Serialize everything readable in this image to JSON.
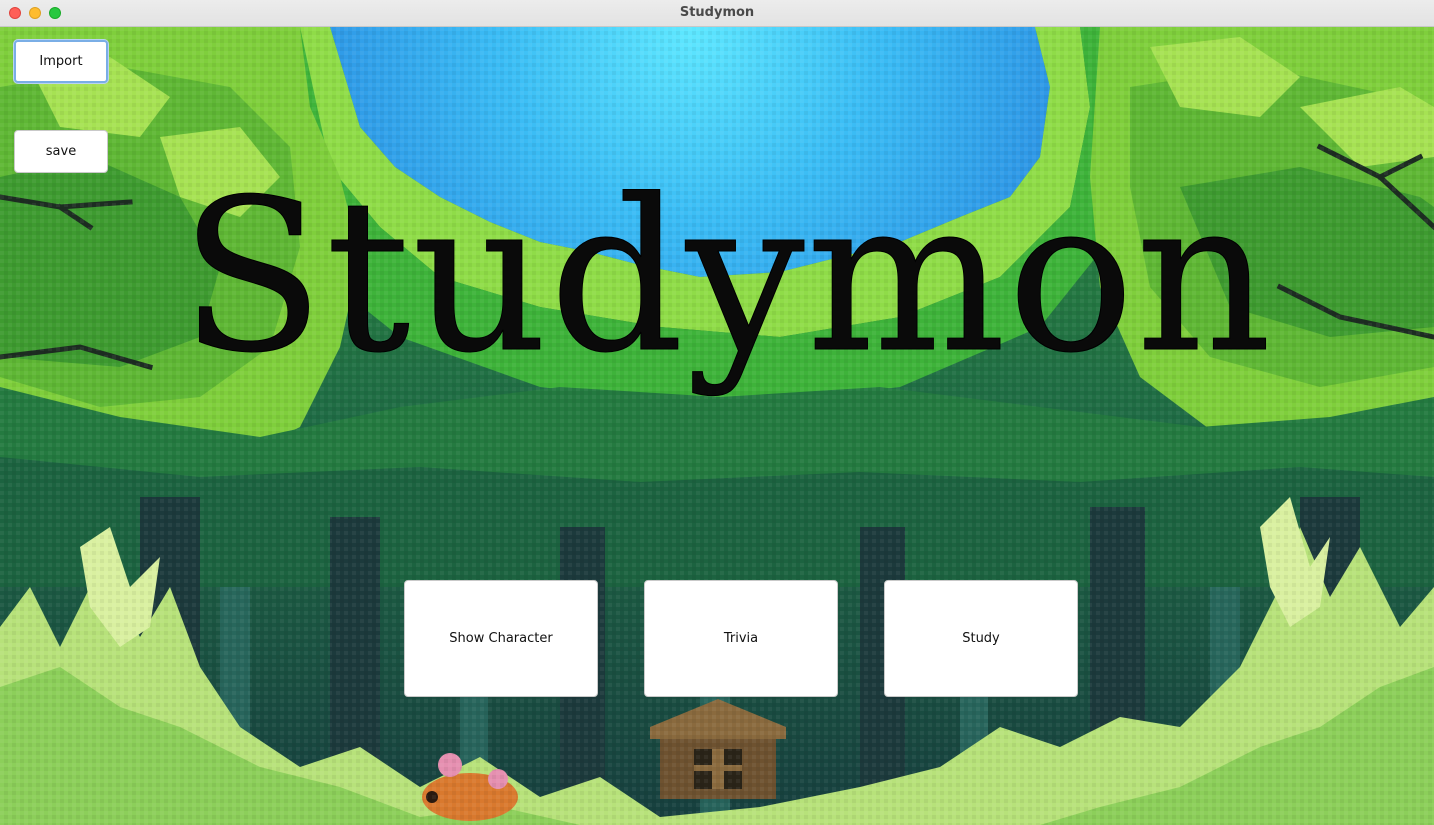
{
  "window": {
    "title": "Studymon"
  },
  "top_buttons": {
    "import_label": "Import",
    "save_label": "save"
  },
  "hero": {
    "title": "Studymon"
  },
  "menu": {
    "show_character_label": "Show Character",
    "trivia_label": "Trivia",
    "study_label": "Study"
  },
  "colors": {
    "sky_light": "#5fe3ff",
    "sky_dark": "#2a8fe0",
    "foliage_light": "#9be04a",
    "foliage_mid": "#3fa63a",
    "foliage_dark": "#1d5a3a",
    "trunk": "#1f3c3c",
    "grass": "#b7e27a"
  },
  "icons": {
    "close": "close-icon",
    "minimize": "minimize-icon",
    "maximize": "maximize-icon"
  }
}
